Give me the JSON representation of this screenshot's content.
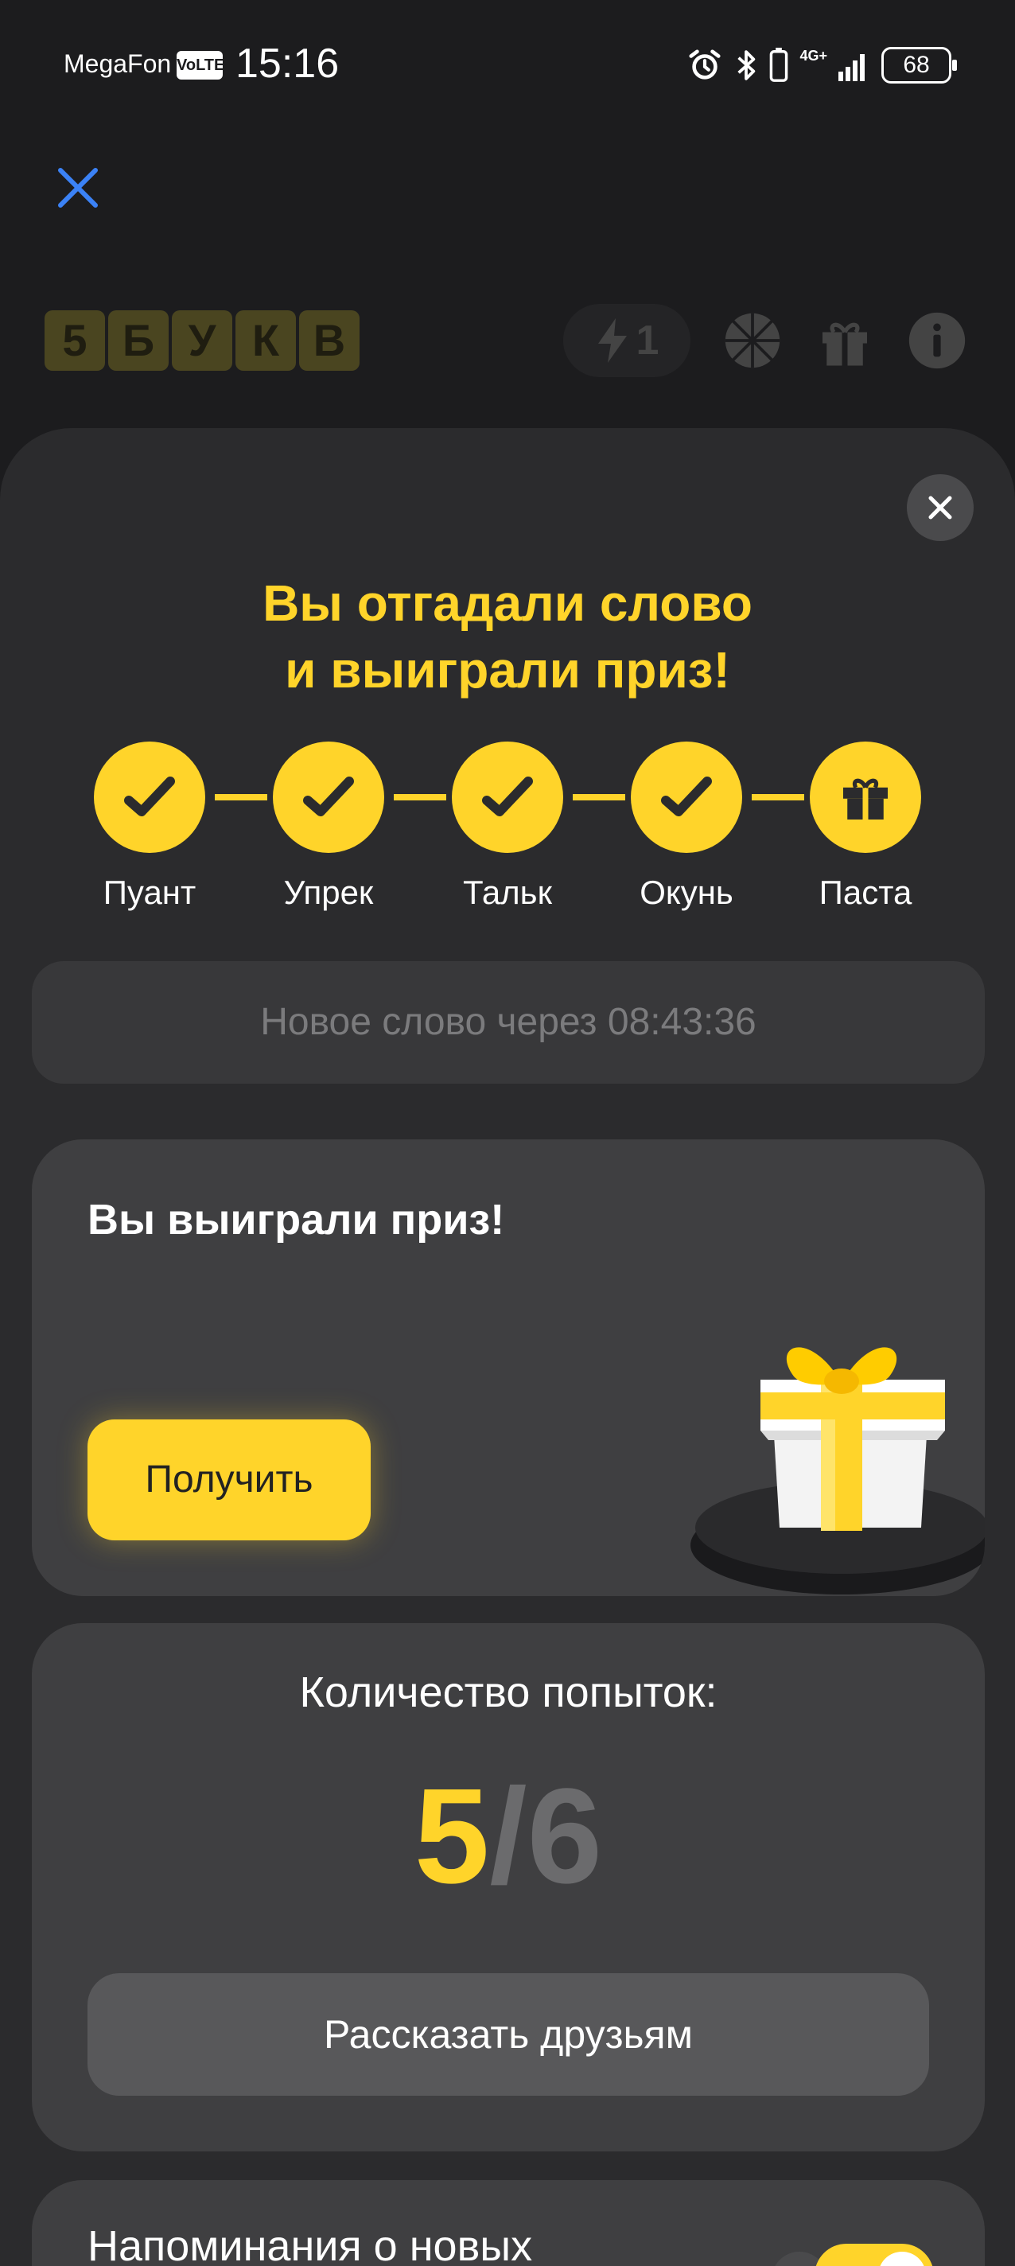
{
  "status_bar": {
    "carrier": "MegaFon",
    "volte": "VoLTE",
    "time": "15:16",
    "network": "4G+",
    "battery": "68"
  },
  "app": {
    "logo_letters": [
      "5",
      "Б",
      "У",
      "К",
      "В"
    ],
    "energy_count": "1"
  },
  "modal": {
    "headline_line1": "Вы отгадали слово",
    "headline_line2": "и выиграли приз!",
    "steps": [
      {
        "label": "Пуант",
        "state": "done"
      },
      {
        "label": "Упрек",
        "state": "done"
      },
      {
        "label": "Тальк",
        "state": "done"
      },
      {
        "label": "Окунь",
        "state": "done"
      },
      {
        "label": "Паста",
        "state": "gift"
      }
    ],
    "timer_text": "Новое слово через 08:43:36",
    "prize": {
      "title": "Вы выиграли приз!",
      "button": "Получить"
    },
    "attempts": {
      "title": "Количество попыток:",
      "used": "5",
      "separator": "/",
      "total": "6",
      "share_button": "Рассказать друзьям"
    },
    "reminder": {
      "text": "Напоминания о новых",
      "toggle_on": true
    }
  },
  "colors": {
    "accent": "#ffd42a",
    "background": "#1c1c1e",
    "sheet": "#2b2b2d",
    "card": "#3f3f41",
    "close_blue": "#3b82f6"
  }
}
